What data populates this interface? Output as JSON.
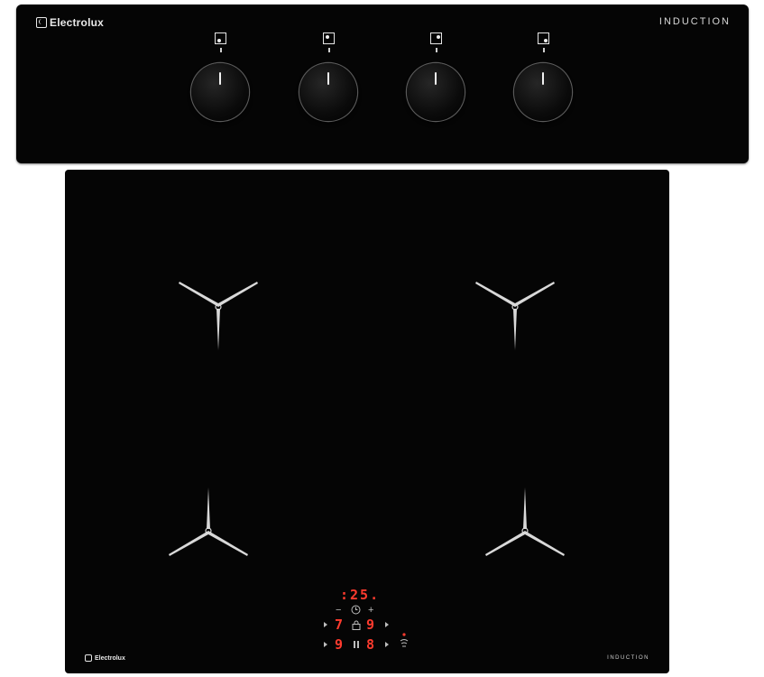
{
  "control_panel": {
    "brand": "Electrolux",
    "label": "INDUCTION",
    "knobs": [
      {
        "name": "rear-left",
        "icon": "zone-rear-left-icon"
      },
      {
        "name": "front-left",
        "icon": "zone-front-left-icon"
      },
      {
        "name": "rear-right",
        "icon": "zone-rear-right-icon"
      },
      {
        "name": "front-right",
        "icon": "zone-front-right-icon"
      }
    ]
  },
  "hob": {
    "brand": "Electrolux",
    "label": "INDUCTION",
    "timer": ":25.",
    "minus": "−",
    "plus": "+",
    "zone_levels": {
      "top_left": "7",
      "top_right": "9",
      "bottom_left": "9",
      "bottom_right": "8"
    },
    "icons": [
      "clock-icon",
      "lock-icon",
      "pause-icon",
      "hob2hood-icon"
    ]
  },
  "colors": {
    "glass": "#050505",
    "display_red": "#ff3b2e",
    "markings": "#d9d9d9"
  }
}
